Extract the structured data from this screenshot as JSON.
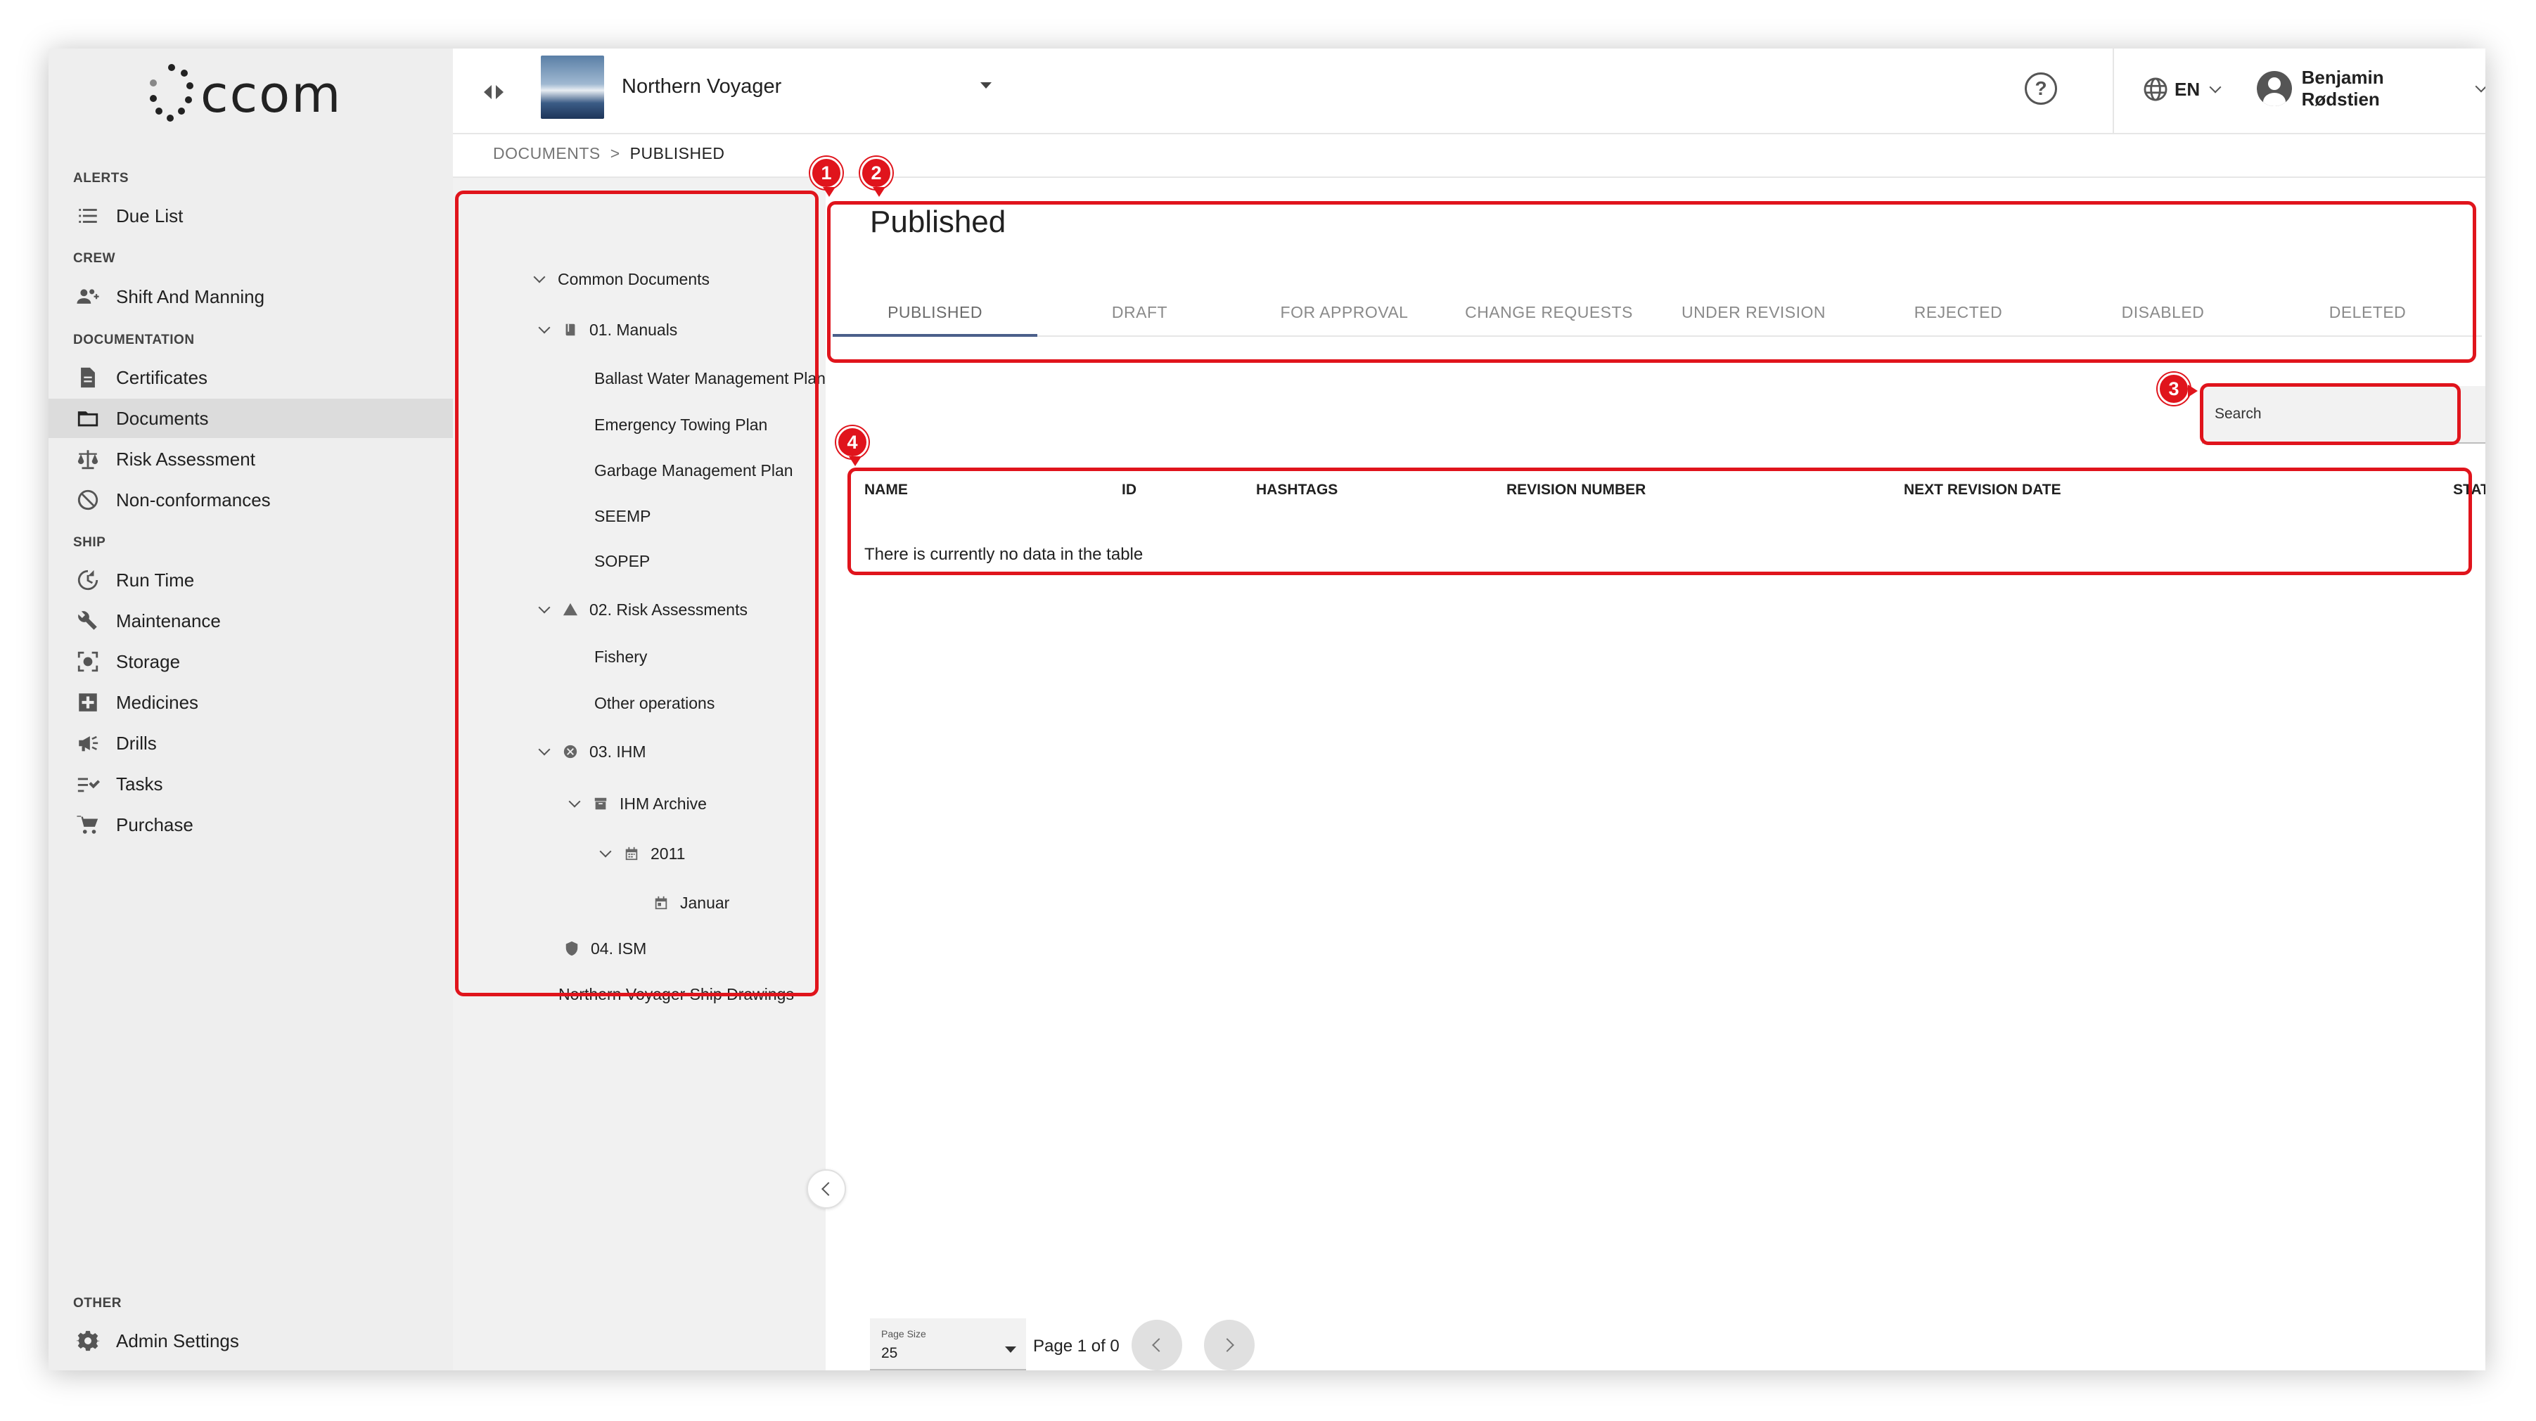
{
  "brand": {
    "logo_text": "ccom"
  },
  "sidebar": {
    "sections": [
      {
        "title": "ALERTS",
        "items": [
          {
            "label": "Due List",
            "icon": "list-icon"
          }
        ]
      },
      {
        "title": "CREW",
        "items": [
          {
            "label": "Shift And Manning",
            "icon": "people-icon"
          }
        ]
      },
      {
        "title": "DOCUMENTATION",
        "items": [
          {
            "label": "Certificates",
            "icon": "file-icon"
          },
          {
            "label": "Documents",
            "icon": "folder-icon",
            "active": true
          },
          {
            "label": "Risk Assessment",
            "icon": "scale-icon"
          },
          {
            "label": "Non-conformances",
            "icon": "no-entry-icon"
          }
        ]
      },
      {
        "title": "SHIP",
        "items": [
          {
            "label": "Run Time",
            "icon": "clock-icon"
          },
          {
            "label": "Maintenance",
            "icon": "wrench-icon"
          },
          {
            "label": "Storage",
            "icon": "storage-icon"
          },
          {
            "label": "Medicines",
            "icon": "medical-cross-icon"
          },
          {
            "label": "Drills",
            "icon": "megaphone-icon"
          },
          {
            "label": "Tasks",
            "icon": "checklist-icon"
          },
          {
            "label": "Purchase",
            "icon": "cart-icon"
          }
        ]
      },
      {
        "title": "OTHER",
        "items": [
          {
            "label": "Admin Settings",
            "icon": "gear-icon"
          }
        ]
      }
    ]
  },
  "topbar": {
    "ship_name": "Northern Voyager",
    "language": "EN",
    "user_name": "Benjamin Rødstien"
  },
  "breadcrumb": {
    "root": "DOCUMENTS",
    "separator": ">",
    "current": "PUBLISHED"
  },
  "tree": {
    "items": [
      {
        "label": "Common Documents",
        "level": 0,
        "chevron": true,
        "icon": ""
      },
      {
        "label": "01. Manuals",
        "level": 1,
        "chevron": true,
        "icon": "book-icon"
      },
      {
        "label": "Ballast Water Management Plan",
        "level": 2
      },
      {
        "label": "Emergency Towing Plan",
        "level": 2
      },
      {
        "label": "Garbage Management Plan",
        "level": 2
      },
      {
        "label": "SEEMP",
        "level": 2
      },
      {
        "label": "SOPEP",
        "level": 2
      },
      {
        "label": "02. Risk Assessments",
        "level": 1,
        "chevron": true,
        "icon": "warning-icon"
      },
      {
        "label": "Fishery",
        "level": 2
      },
      {
        "label": "Other operations",
        "level": 2
      },
      {
        "label": "03. IHM",
        "level": 1,
        "chevron": true,
        "icon": "cancel-circle-icon"
      },
      {
        "label": "IHM Archive",
        "level": 2,
        "chevron": true,
        "icon": "archive-icon"
      },
      {
        "label": "2011",
        "level": 3,
        "chevron": true,
        "icon": "calendar-icon"
      },
      {
        "label": "Januar",
        "level": 4,
        "icon": "calendar-day-icon"
      },
      {
        "label": "04. ISM",
        "level": 1,
        "icon": "shield-icon"
      },
      {
        "label": "Northern Voyager Ship Drawings",
        "level": 0
      }
    ]
  },
  "main": {
    "title": "Published",
    "tabs": [
      {
        "label": "PUBLISHED",
        "active": true
      },
      {
        "label": "DRAFT"
      },
      {
        "label": "FOR APPROVAL"
      },
      {
        "label": "CHANGE REQUESTS"
      },
      {
        "label": "UNDER REVISION"
      },
      {
        "label": "REJECTED"
      },
      {
        "label": "DISABLED"
      },
      {
        "label": "DELETED"
      }
    ],
    "search_placeholder": "Search",
    "table": {
      "columns": [
        "NAME",
        "ID",
        "HASHTAGS",
        "REVISION NUMBER",
        "NEXT REVISION DATE",
        "STATUS"
      ],
      "empty_message": "There is currently no data in the table"
    },
    "pagination": {
      "page_size_label": "Page Size",
      "page_size_value": "25",
      "page_info": "Page 1 of 0"
    }
  },
  "annotations": {
    "badges": [
      "1",
      "2",
      "3",
      "4"
    ],
    "color": "#e0141c"
  }
}
